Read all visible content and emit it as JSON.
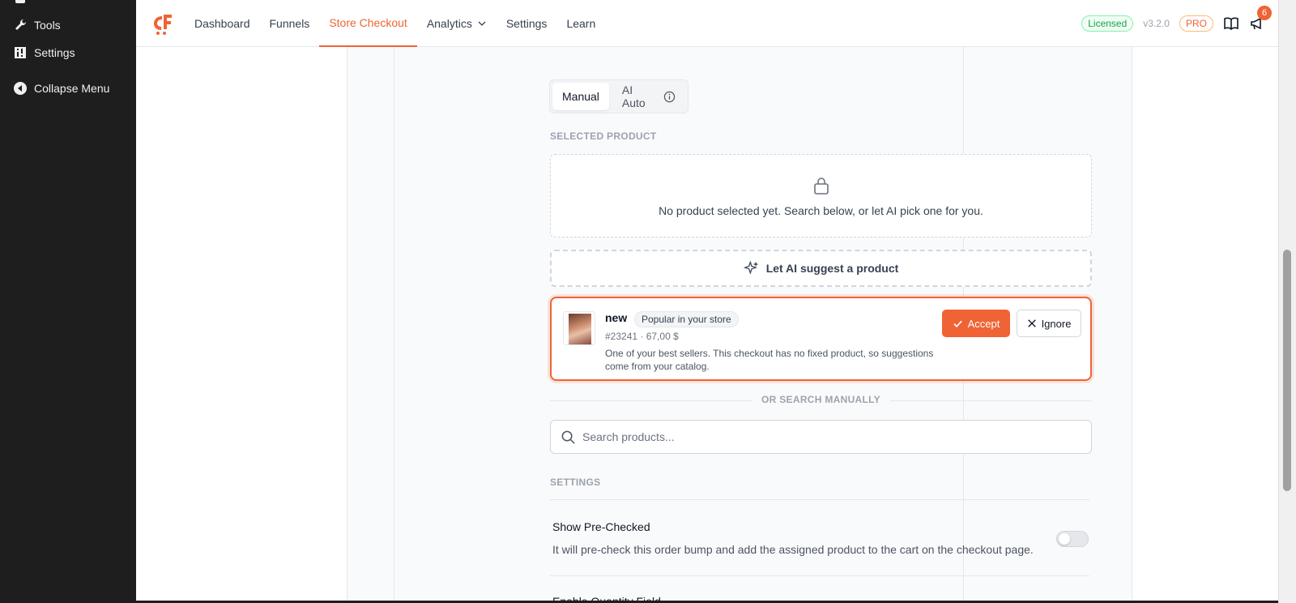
{
  "wp_sidebar": {
    "items": [
      {
        "label": "Tools",
        "icon": "wrench-icon"
      },
      {
        "label": "Settings",
        "icon": "settings-grid-icon"
      },
      {
        "label": "Collapse Menu",
        "icon": "collapse-arrow-icon"
      }
    ]
  },
  "topbar": {
    "nav": [
      {
        "label": "Dashboard"
      },
      {
        "label": "Funnels"
      },
      {
        "label": "Store Checkout"
      },
      {
        "label": "Analytics"
      },
      {
        "label": "Settings"
      },
      {
        "label": "Learn"
      }
    ],
    "licensed": "Licensed",
    "version": "v3.2.0",
    "pro": "PRO",
    "notification_count": "6"
  },
  "mode": {
    "manual": "Manual",
    "ai_auto": "AI Auto"
  },
  "selected_product": {
    "label": "SELECTED PRODUCT",
    "empty_text": "No product selected yet. Search below, or let AI pick one for you."
  },
  "ai_suggest_button": "Let AI suggest a product",
  "suggestion": {
    "name": "new",
    "pill": "Popular in your store",
    "meta": "#23241 · 67,00 $",
    "description": "One of your best sellers. This checkout has no fixed product, so suggestions come from your catalog.",
    "accept": "Accept",
    "ignore": "Ignore"
  },
  "search": {
    "divider": "OR SEARCH MANUALLY",
    "placeholder": "Search products..."
  },
  "settings": {
    "label": "SETTINGS",
    "pre_checked_title": "Show Pre-Checked",
    "pre_checked_desc": "It will pre-check this order bump and add the assigned product to the cart on the checkout page.",
    "pre_checked_value": false,
    "next_title": "Enable Quantity Field"
  },
  "colors": {
    "accent": "#f06335",
    "sidebar": "#1e1e1e"
  }
}
